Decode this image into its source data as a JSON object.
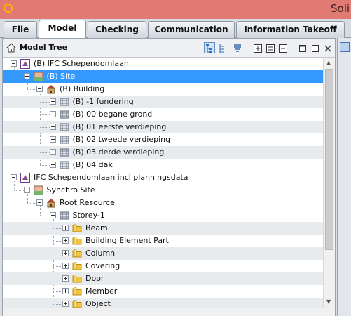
{
  "window": {
    "title": "Soli"
  },
  "tabs": [
    {
      "label": "File",
      "active": false
    },
    {
      "label": "Model",
      "active": true
    },
    {
      "label": "Checking",
      "active": false
    },
    {
      "label": "Communication",
      "active": false
    },
    {
      "label": "Information Takeoff",
      "active": false
    }
  ],
  "panel": {
    "title": "Model Tree",
    "toolbar": [
      "tree-layout-icon",
      "tree-structure-icon",
      "filter-icon",
      "expand-all-icon",
      "collapse-all-icon",
      "collapse-icon",
      "restore-icon",
      "maximize-icon",
      "close-icon"
    ]
  },
  "tree": {
    "rows": [
      {
        "label": "(B) IFC Schependomlaan",
        "icon": "model-icon",
        "selected": false,
        "alt": false
      },
      {
        "label": "(B) Site",
        "icon": "site-icon",
        "selected": true,
        "alt": false
      },
      {
        "label": "(B) Building",
        "icon": "building-icon",
        "selected": false,
        "alt": false
      },
      {
        "label": "(B) -1 fundering",
        "icon": "storey-icon",
        "selected": false,
        "alt": true
      },
      {
        "label": "(B) 00 begane grond",
        "icon": "storey-icon",
        "selected": false,
        "alt": false
      },
      {
        "label": "(B) 01 eerste verdieping",
        "icon": "storey-icon",
        "selected": false,
        "alt": true
      },
      {
        "label": "(B) 02 tweede verdieping",
        "icon": "storey-icon",
        "selected": false,
        "alt": false
      },
      {
        "label": "(B) 03 derde verdieping",
        "icon": "storey-icon",
        "selected": false,
        "alt": true
      },
      {
        "label": "(B) 04 dak",
        "icon": "storey-icon",
        "selected": false,
        "alt": false
      },
      {
        "label": "IFC Schependomlaan incl planningsdata",
        "icon": "model-icon",
        "selected": false,
        "alt": false
      },
      {
        "label": "Synchro Site",
        "icon": "site-icon",
        "selected": false,
        "alt": false
      },
      {
        "label": "Root Resource",
        "icon": "building-icon",
        "selected": false,
        "alt": false
      },
      {
        "label": "Storey-1",
        "icon": "storey-icon",
        "selected": false,
        "alt": false
      },
      {
        "label": "Beam",
        "icon": "folder-icon",
        "selected": false,
        "alt": true
      },
      {
        "label": "Building Element Part",
        "icon": "folder-icon",
        "selected": false,
        "alt": false
      },
      {
        "label": "Column",
        "icon": "folder-icon",
        "selected": false,
        "alt": true
      },
      {
        "label": "Covering",
        "icon": "folder-icon",
        "selected": false,
        "alt": false
      },
      {
        "label": "Door",
        "icon": "folder-icon",
        "selected": false,
        "alt": true
      },
      {
        "label": "Member",
        "icon": "folder-icon",
        "selected": false,
        "alt": false
      },
      {
        "label": "Object",
        "icon": "folder-icon",
        "selected": false,
        "alt": true
      }
    ]
  },
  "colors": {
    "titlebar": "#e07a72",
    "selection": "#3399ff",
    "folder": "#f2c641",
    "alt_row": "#e8ebee"
  }
}
